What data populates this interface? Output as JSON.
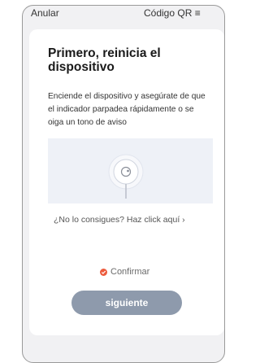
{
  "header": {
    "cancel_label": "Anular",
    "qr_label": "Código QR ≡"
  },
  "card": {
    "title": "Primero, reinicia el dispositivo",
    "description": "Enciende el dispositivo y asegúrate de que el indicador parpadea rápidamente o se oiga un tono de aviso",
    "help_link": "¿No lo consigues? Haz click aquí ›",
    "confirm_label": "Confirmar",
    "next_label": "siguiente"
  },
  "colors": {
    "accent": "#ec5a3c",
    "button": "#8e9aac",
    "illustration_bg": "#eef1f7"
  },
  "icons": [
    "device-reset-icon",
    "check-icon"
  ]
}
